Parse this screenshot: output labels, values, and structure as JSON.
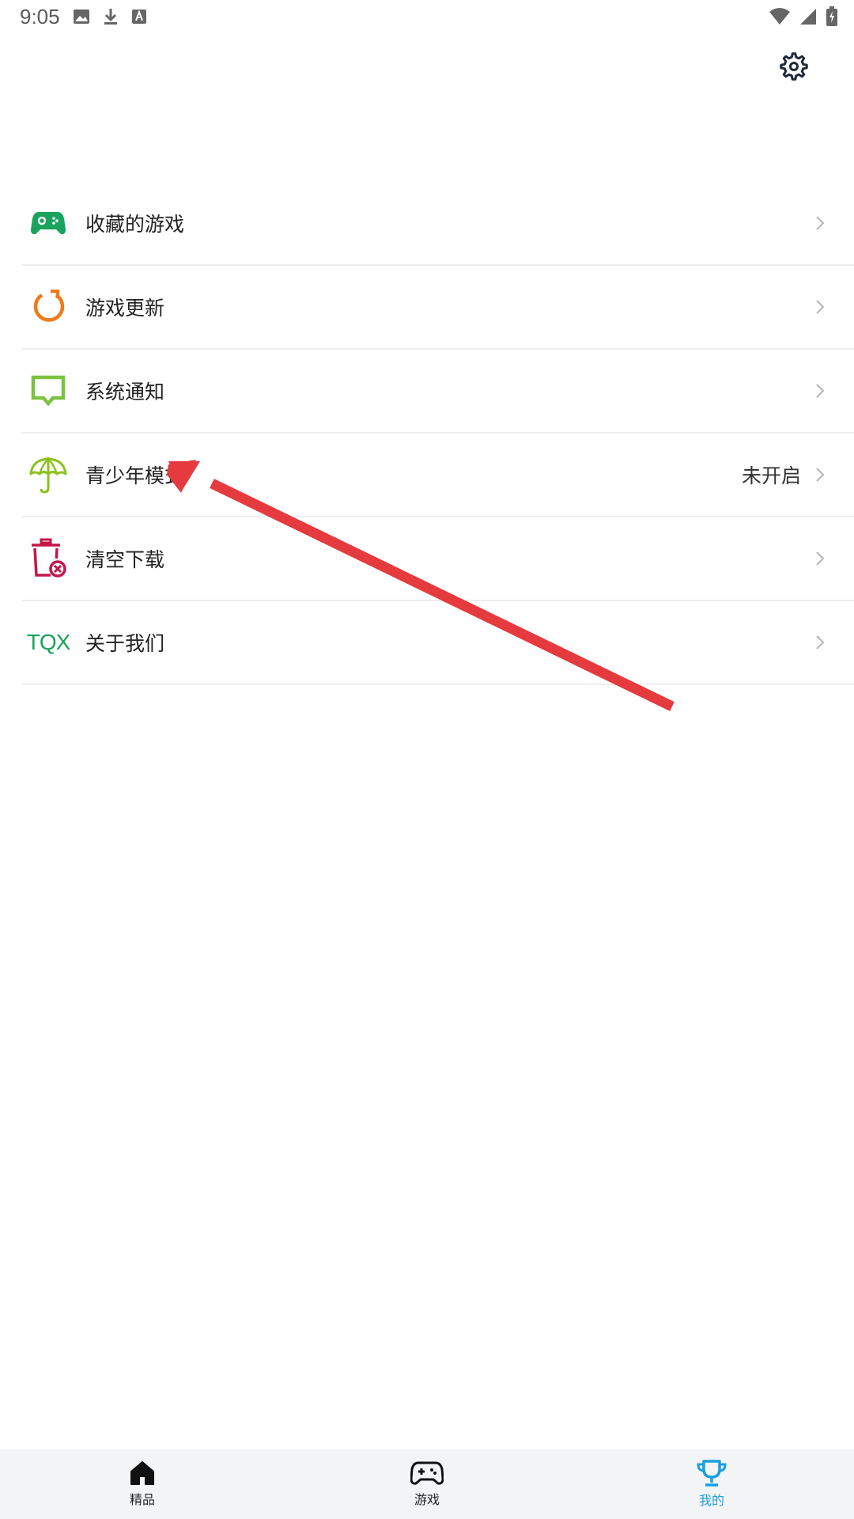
{
  "status_bar": {
    "time": "9:05",
    "left_icons": [
      "image-icon",
      "download-icon",
      "font-a-icon"
    ],
    "right_icons": [
      "wifi-icon",
      "signal-icon",
      "battery-icon"
    ]
  },
  "header": {
    "settings_icon": "gear-icon"
  },
  "menu": {
    "items": [
      {
        "label": "收藏的游戏",
        "icon": "gamepad-icon",
        "color": "#1aa35c"
      },
      {
        "label": "游戏更新",
        "icon": "refresh-icon",
        "color": "#ee7b1a"
      },
      {
        "label": "系统通知",
        "icon": "message-icon",
        "color": "#7cc242"
      },
      {
        "label": "青少年模式",
        "value": "未开启",
        "icon": "umbrella-icon",
        "color": "#8dc21f"
      },
      {
        "label": "清空下载",
        "icon": "trash-clear-icon",
        "color": "#c3174a"
      },
      {
        "label": "关于我们",
        "icon_text": "TQX",
        "color": "#1aa35c"
      }
    ]
  },
  "annotation": {
    "color": "#e53a3e"
  },
  "bottom_nav": {
    "items": [
      {
        "label": "精品",
        "icon": "home-icon"
      },
      {
        "label": "游戏",
        "icon": "gamepad-icon"
      },
      {
        "label": "我的",
        "icon": "trophy-icon",
        "active": true
      }
    ],
    "active_color": "#1aa0df"
  }
}
